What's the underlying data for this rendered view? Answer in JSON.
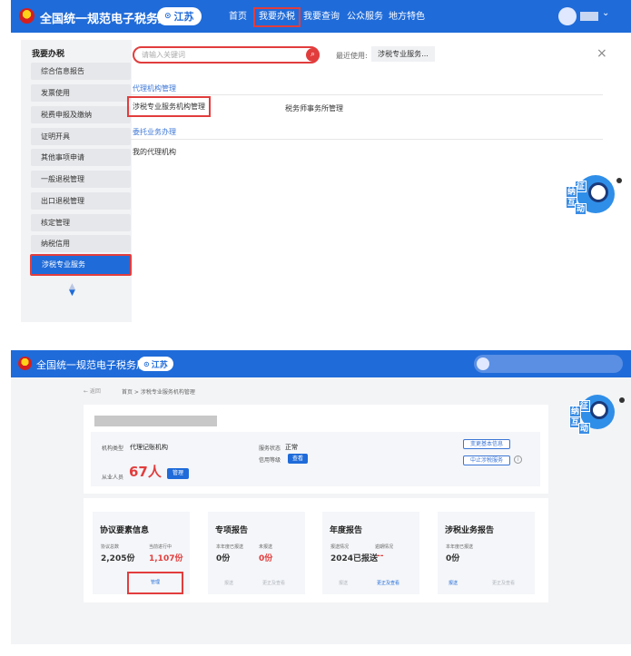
{
  "screen1": {
    "header": {
      "site_title": "全国统一规范电子税务局",
      "province": "江苏",
      "nav": [
        "首页",
        "我要办税",
        "我要查询",
        "公众服务",
        "地方特色"
      ],
      "user_dropdown": "⌄"
    },
    "sidebar": {
      "title": "我要办税",
      "items": [
        "综合信息报告",
        "发票使用",
        "税费申报及缴纳",
        "证明开具",
        "其他事项申请",
        "一般退税管理",
        "出口退税管理",
        "核定管理",
        "纳税信用",
        "涉税专业服务"
      ]
    },
    "search": {
      "placeholder": "请输入关键词",
      "recent_label": "最近使用:",
      "recent_item": "涉税专业服务..."
    },
    "sections": [
      {
        "title": "代理机构管理",
        "links": [
          "涉税专业服务机构管理",
          "税务师事务所管理"
        ]
      },
      {
        "title": "委托业务办理",
        "links": [
          "我的代理机构"
        ]
      }
    ],
    "mascot": {
      "chars": [
        "征",
        "纳",
        "互",
        "动"
      ]
    }
  },
  "screen2": {
    "header": {
      "site_title": "全国统一规范电子税务局",
      "province": "江苏"
    },
    "breadcrumb": {
      "back": "← 返回",
      "path": "首页 > 涉税专业服务机构管理"
    },
    "info": {
      "type_label": "机构类型",
      "type_value": "代理记账机构",
      "status_label": "服务状态",
      "status_value": "正常",
      "credit_label": "信用等级",
      "credit_button": "查看",
      "staff_label": "从业人员",
      "staff_value": "67人",
      "staff_button": "管理",
      "change_button": "变更基本信息",
      "stop_button": "中止涉税服务"
    },
    "reports": [
      {
        "title": "协议要素信息",
        "sub1": "协议总数",
        "val1": "2,205份",
        "sub2": "当前进行中",
        "val2": "1,107份",
        "actions": [
          "管理"
        ]
      },
      {
        "title": "专项报告",
        "sub1": "本年度已报送",
        "val1": "0份",
        "sub2": "未报送",
        "val2": "0份",
        "actions": [
          "报送",
          "更正及查看"
        ]
      },
      {
        "title": "年度报告",
        "sub1": "报送情况",
        "val1": "2024已报送",
        "sub2": "逾期情况",
        "val2": "--",
        "actions": [
          "报送",
          "更正及查看"
        ]
      },
      {
        "title": "涉税业务报告",
        "sub1": "本年度已报送",
        "val1": "0份",
        "actions": [
          "报送",
          "更正及查看"
        ]
      }
    ]
  },
  "colors": {
    "brand_blue": "#1f6bd9",
    "highlight_red": "#e23d3d"
  }
}
